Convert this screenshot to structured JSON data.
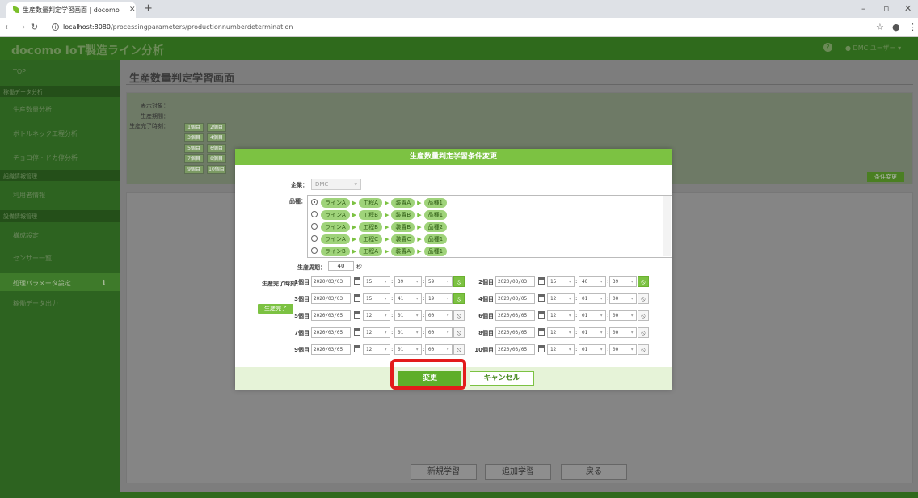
{
  "browser": {
    "tab_title": "生産数量判定学習画面 | docomo",
    "url_host": "localhost:8080",
    "url_path": "/processingparameters/productionnumberdetermination"
  },
  "app": {
    "title": "docomo IoT製造ライン分析",
    "user": "DMC ユーザー"
  },
  "sidebar": {
    "top": "TOP",
    "sections": [
      {
        "label": "稼働データ分析"
      },
      {
        "label": "組織情報管理"
      },
      {
        "label": "設備情報管理"
      }
    ],
    "items": [
      {
        "label": "生産数量分析"
      },
      {
        "label": "ボトルネック工程分析"
      },
      {
        "label": "チョコ停・ドカ停分析"
      },
      {
        "label": "利用者情報"
      },
      {
        "label": "構成設定"
      },
      {
        "label": "センサー一覧"
      },
      {
        "label": "処理パラメータ設定"
      },
      {
        "label": "稼働データ出力"
      }
    ]
  },
  "page": {
    "title": "生産数量判定学習画面",
    "info_labels": [
      "表示対象：",
      "生産期間：",
      "生産完了時刻："
    ],
    "time_grid": [
      "1個目",
      "2個目",
      "3個目",
      "4個目",
      "5個目",
      "6個目",
      "7個目",
      "8個目",
      "9個目",
      "10個目"
    ],
    "change_btn": "条件変更",
    "buttons": {
      "new_learn": "新規学習",
      "add_learn": "追加学習",
      "back": "戻る"
    }
  },
  "modal": {
    "title": "生産数量判定学習条件変更",
    "company_label": "企業：",
    "company_value": "DMC",
    "product_label": "品種：",
    "products": [
      [
        "ラインA",
        "工程A",
        "装置A",
        "品種1"
      ],
      [
        "ラインA",
        "工程B",
        "装置B",
        "品種1"
      ],
      [
        "ラインA",
        "工程B",
        "装置B",
        "品種2"
      ],
      [
        "ラインA",
        "工程C",
        "装置C",
        "品種1"
      ],
      [
        "ラインB",
        "工程A",
        "装置A",
        "品種1"
      ]
    ],
    "cycle_label": "生産周期：",
    "cycle_value": "40",
    "cycle_unit": "秒",
    "completion_label": "生産完了時刻：",
    "production_done_btn": "生産完了",
    "slots": [
      {
        "n": "1個目",
        "date": "2020/03/03",
        "h": "15",
        "m": "39",
        "s": "59",
        "active": true
      },
      {
        "n": "2個目",
        "date": "2020/03/03",
        "h": "15",
        "m": "40",
        "s": "39",
        "active": true
      },
      {
        "n": "3個目",
        "date": "2020/03/03",
        "h": "15",
        "m": "41",
        "s": "19",
        "active": true
      },
      {
        "n": "4個目",
        "date": "2020/03/05",
        "h": "12",
        "m": "01",
        "s": "00",
        "active": false
      },
      {
        "n": "5個目",
        "date": "2020/03/05",
        "h": "12",
        "m": "01",
        "s": "00",
        "active": false
      },
      {
        "n": "6個目",
        "date": "2020/03/05",
        "h": "12",
        "m": "01",
        "s": "00",
        "active": false
      },
      {
        "n": "7個目",
        "date": "2020/03/05",
        "h": "12",
        "m": "01",
        "s": "00",
        "active": false
      },
      {
        "n": "8個目",
        "date": "2020/03/05",
        "h": "12",
        "m": "01",
        "s": "00",
        "active": false
      },
      {
        "n": "9個目",
        "date": "2020/03/05",
        "h": "12",
        "m": "01",
        "s": "00",
        "active": false
      },
      {
        "n": "10個目",
        "date": "2020/03/05",
        "h": "12",
        "m": "01",
        "s": "00",
        "active": false
      }
    ],
    "confirm_btn": "変更",
    "cancel_btn": "キャンセル"
  }
}
